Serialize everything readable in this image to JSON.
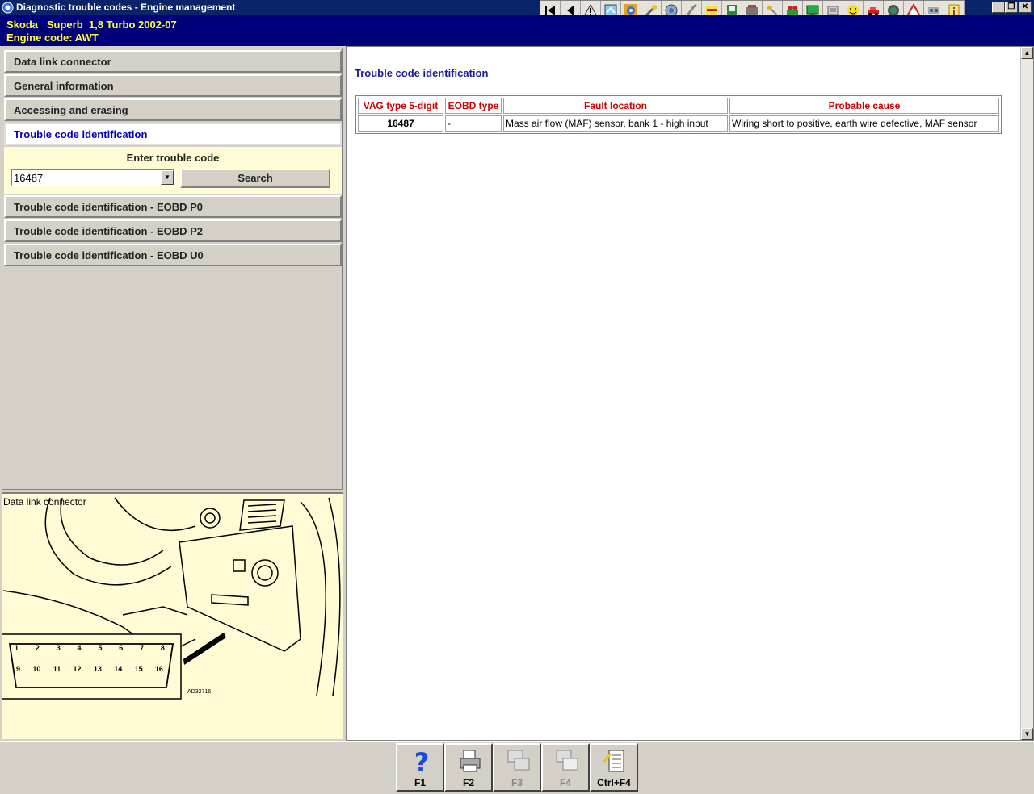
{
  "window": {
    "title": "Diagnostic trouble codes - Engine management",
    "controls": [
      "_",
      "❐",
      "✕"
    ]
  },
  "toolbar": {
    "icons": [
      "first-icon",
      "back-icon",
      "warning-icon",
      "manual-icon",
      "gear-icon",
      "tools-icon",
      "disc-icon",
      "wrench-icon",
      "electrics-icon",
      "door-icon",
      "engine-icon",
      "key-icon",
      "fault-icon",
      "display-icon",
      "component-icon",
      "smiley-icon",
      "car-icon",
      "wheel-icon",
      "hazard-icon",
      "parts-icon",
      "info-icon"
    ]
  },
  "vehicle": {
    "line1": "Skoda   Superb  1,8 Turbo 2002-07",
    "line2": "Engine code: AWT"
  },
  "nav": {
    "items": [
      {
        "label": "Data link connector"
      },
      {
        "label": "General information"
      },
      {
        "label": "Accessing and erasing"
      },
      {
        "label": "Trouble code identification"
      },
      {
        "label": "Trouble code identification - EOBD P0"
      },
      {
        "label": "Trouble code identification - EOBD P2"
      },
      {
        "label": "Trouble code identification - EOBD U0"
      }
    ]
  },
  "search": {
    "label": "Enter trouble code",
    "value": "16487",
    "button": "Search"
  },
  "image_panel": {
    "caption": "Data link connector",
    "pins_top": [
      "1",
      "2",
      "3",
      "4",
      "5",
      "6",
      "7",
      "8"
    ],
    "pins_bottom": [
      "9",
      "10",
      "11",
      "12",
      "13",
      "14",
      "15",
      "16"
    ],
    "ref": "AD32716"
  },
  "content": {
    "heading": "Trouble code identification",
    "columns": [
      "VAG type 5-digit",
      "EOBD type",
      "Fault location",
      "Probable cause"
    ],
    "rows": [
      {
        "vag": "16487",
        "eobd": "-",
        "fault": "Mass air flow (MAF) sensor, bank 1 - high input",
        "cause": "Wiring short to positive, earth wire defective, MAF sensor"
      }
    ]
  },
  "fkeys": [
    {
      "label": "F1",
      "icon": "help-icon",
      "enabled": true
    },
    {
      "label": "F2",
      "icon": "print-icon",
      "enabled": true
    },
    {
      "label": "F3",
      "icon": "copy-icon",
      "enabled": false
    },
    {
      "label": "F4",
      "icon": "paste-icon",
      "enabled": false
    },
    {
      "label": "Ctrl+F4",
      "icon": "notes-icon",
      "enabled": true
    }
  ]
}
